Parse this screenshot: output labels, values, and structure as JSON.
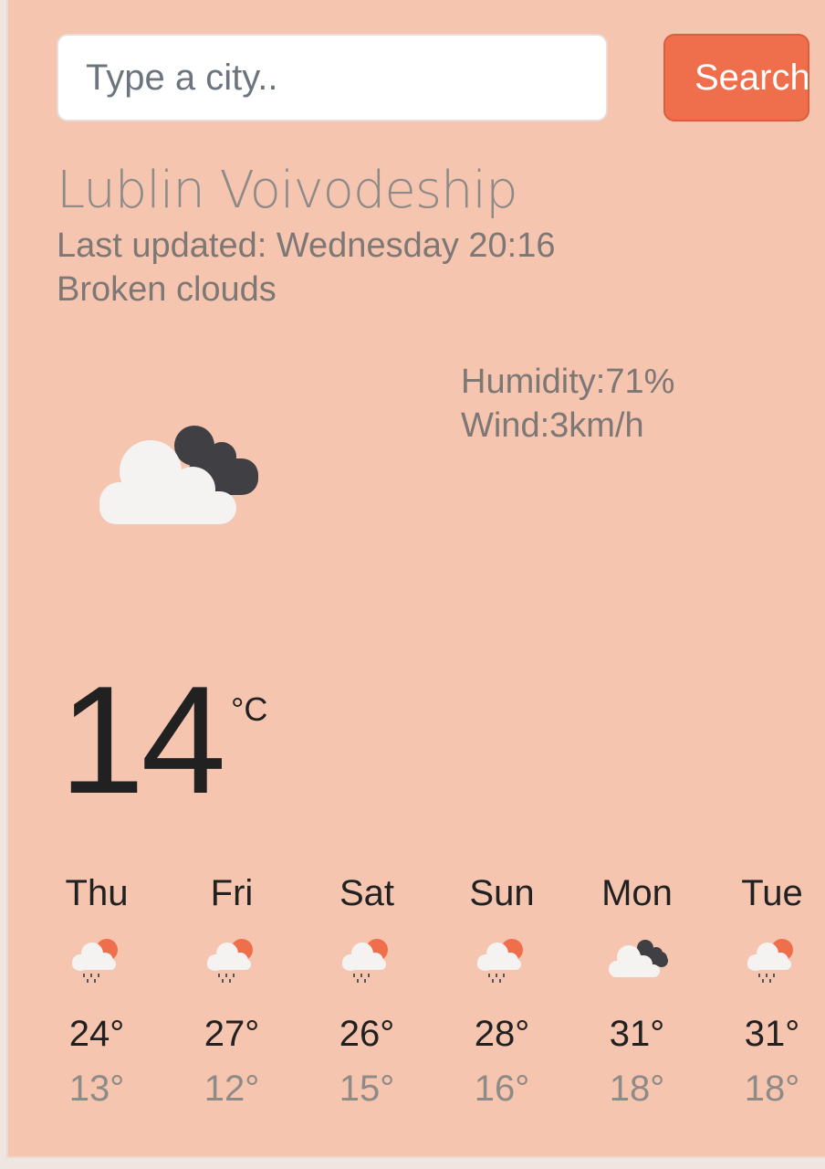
{
  "search": {
    "placeholder": "Type a city..",
    "value": "",
    "button_label": "Search"
  },
  "current": {
    "city": "Lublin Voivodeship",
    "last_updated": "Last updated: Wednesday 20:16",
    "description": "Broken clouds",
    "humidity": "Humidity:71%",
    "wind": "Wind:3km/h",
    "temperature": "14",
    "unit": "°C",
    "icon": "broken-clouds-icon"
  },
  "forecast": [
    {
      "day": "Thu",
      "max": "24°",
      "min": "13°",
      "icon": "rain-sun-icon"
    },
    {
      "day": "Fri",
      "max": "27°",
      "min": "12°",
      "icon": "rain-sun-icon"
    },
    {
      "day": "Sat",
      "max": "26°",
      "min": "15°",
      "icon": "rain-sun-icon"
    },
    {
      "day": "Sun",
      "max": "28°",
      "min": "16°",
      "icon": "rain-sun-icon"
    },
    {
      "day": "Mon",
      "max": "31°",
      "min": "18°",
      "icon": "broken-clouds-icon"
    },
    {
      "day": "Tue",
      "max": "31°",
      "min": "18°",
      "icon": "rain-sun-icon"
    }
  ],
  "colors": {
    "background": "#f5c5af",
    "accent": "#ef6f4d",
    "primary_text": "#212121",
    "secondary_text": "#7d7775"
  }
}
